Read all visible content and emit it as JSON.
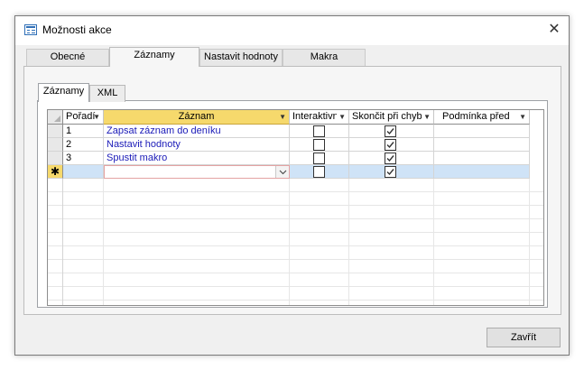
{
  "window": {
    "title": "Možnosti akce",
    "close_glyph": "✕",
    "icon": "macro-window-icon"
  },
  "tabs": [
    {
      "label": "Obecné",
      "active": false
    },
    {
      "label": "Záznamy",
      "active": true
    },
    {
      "label": "Nastavit hodnoty",
      "active": false
    },
    {
      "label": "Makra",
      "active": false
    }
  ],
  "inner_tabs": [
    {
      "label": "Záznamy",
      "active": true
    },
    {
      "label": "XML",
      "active": false
    }
  ],
  "grid": {
    "columns": [
      "Pořadí",
      "Záznam",
      "Interaktivní",
      "Skončit při chybě",
      "Podmínka před"
    ],
    "rows": [
      {
        "order": "1",
        "record": "Zapsat záznam do deníku",
        "interactive": false,
        "stop_on_error": true,
        "condition": ""
      },
      {
        "order": "2",
        "record": "Nastavit hodnoty",
        "interactive": false,
        "stop_on_error": true,
        "condition": ""
      },
      {
        "order": "3",
        "record": "Spustit makro",
        "interactive": false,
        "stop_on_error": true,
        "condition": ""
      }
    ],
    "new_row": {
      "marker": "✱",
      "interactive": false,
      "stop_on_error": true
    },
    "colors": {
      "header_selected": "#f6d96c",
      "new_row": "#cfe3f7",
      "link": "#1a1ab8"
    }
  },
  "footer": {
    "close_button": "Zavřít"
  }
}
